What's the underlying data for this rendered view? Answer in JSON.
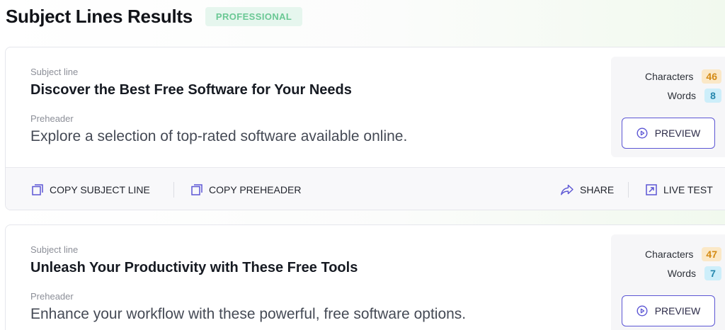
{
  "header": {
    "title": "Subject Lines Results",
    "plan_badge": "PROFESSIONAL"
  },
  "colors": {
    "accent": "#5c56d4",
    "badge_text": "#6ac894",
    "characters_badge": "#d48a13",
    "words_badge": "#2587ad"
  },
  "labels": {
    "subject_line": "Subject line",
    "preheader": "Preheader",
    "characters": "Characters",
    "words": "Words",
    "preview": "PREVIEW",
    "copy_subject_line": "COPY SUBJECT LINE",
    "copy_preheader": "COPY PREHEADER",
    "share": "SHARE",
    "live_test": "LIVE TEST"
  },
  "results": [
    {
      "subject": "Discover the Best Free Software for Your Needs",
      "preheader": "Explore a selection of top-rated software available online.",
      "characters": "46",
      "words": "8"
    },
    {
      "subject": "Unleash Your Productivity with These Free Tools",
      "preheader": "Enhance your workflow with these powerful, free software options.",
      "characters": "47",
      "words": "7"
    }
  ],
  "icons": {
    "preview": "play-circle-icon",
    "copy": "copy-icon",
    "share": "share-arrow-icon",
    "live_test": "external-link-icon"
  }
}
